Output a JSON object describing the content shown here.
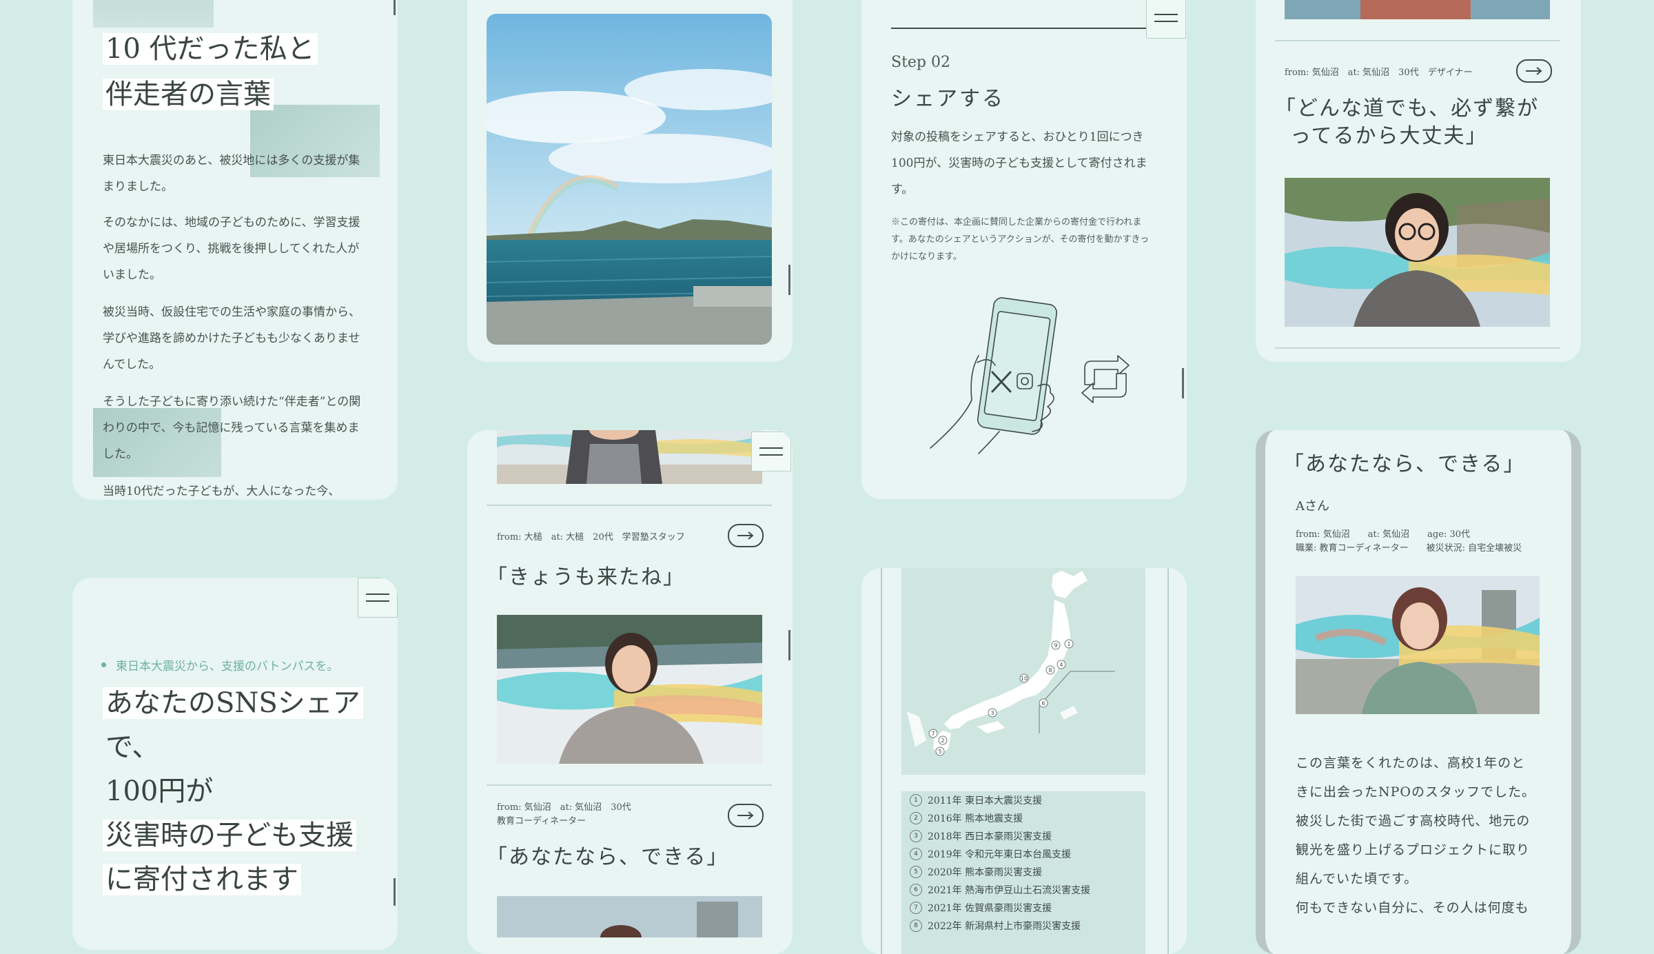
{
  "card1": {
    "title_line1": "10 代だった私と",
    "title_line2": "伴走者の言葉",
    "p1": "東日本大震災のあと、被災地には多くの支援が集まりました。",
    "p2": "そのなかには、地域の子どものために、学習支援や居場所をつくり、挑戦を後押ししてくれた人がいました。",
    "p3": "被災当時、仮設住宅での生活や家庭の事情から、学びや進路を諦めかけた子どもも少なくありませんでした。",
    "p4": "そうした子どもに寄り添い続けた“伴走者”との関わりの中で、今も記憶に残っている言葉を集めました。",
    "p5": "当時10代だった子どもが、大人になった今、"
  },
  "card2": {
    "tagline": "東日本大震災から、支援のバトンパスを。",
    "headline_l1": "あなたのSNSシェア",
    "headline_l2": "で、",
    "headline_l3": "100円が",
    "headline_l4": "災害時の子ども支援",
    "headline_l5": "に寄付されます"
  },
  "card4": {
    "meta": "from: 大槌　at: 大槌　20代　学習塾スタッフ",
    "quote": "「きょうも来たね」",
    "meta2_l1": "from: 気仙沼　at: 気仙沼　30代",
    "meta2_l2": "教育コーディネーター",
    "quote2": "「あなたなら、できる」"
  },
  "card5": {
    "step": "Step 02",
    "title": "シェアする",
    "body": "対象の投稿をシェアすると、おひとり1回につき100円が、災害時の子ども支援として寄付されます。",
    "note": "※この寄付は、本企画に賛同した企業からの寄付金で行われます。あなたのシェアというアクションが、その寄付を動かすきっかけになります。"
  },
  "card6": {
    "legend": [
      {
        "n": "1",
        "text": "2011年  東日本大震災支援"
      },
      {
        "n": "2",
        "text": "2016年  熊本地震支援"
      },
      {
        "n": "3",
        "text": "2018年  西日本豪雨災害支援"
      },
      {
        "n": "4",
        "text": "2019年  令和元年東日本台風支援"
      },
      {
        "n": "5",
        "text": "2020年  熊本豪雨災害支援"
      },
      {
        "n": "6",
        "text": "2021年  熱海市伊豆山土石流災害支援"
      },
      {
        "n": "7",
        "text": "2021年  佐賀県豪雨災害支援"
      },
      {
        "n": "8",
        "text": "2022年  新潟県村上市豪雨災害支援"
      }
    ]
  },
  "card7": {
    "meta": "from: 気仙沼　at: 気仙沼　30代　デザイナー",
    "quote_l1": "「どんな道でも、必ず繋が",
    "quote_l2": "ってるから大丈夫」"
  },
  "card8": {
    "quote": "「あなたなら、できる」",
    "name": "Aさん",
    "meta_l1": "from: 気仙沼　　at: 気仙沼　　age: 30代",
    "meta_l2": "職業: 教育コーディネーター　　被災状況: 自宅全壊被災",
    "body_l1": "この言葉をくれたのは、高校1年のと",
    "body_l2": "きに出会ったNPOのスタッフでした。",
    "body_l3": "被災した街で過ごす高校時代、地元の",
    "body_l4": "観光を盛り上げるプロジェクトに取り",
    "body_l5": "組んでいた頃です。",
    "body_l6": "何もできない自分に、その人は何度も"
  },
  "colors": {
    "background": "#d3ece6",
    "card": "#e8f5f2",
    "accent": "#6fb0a4"
  }
}
